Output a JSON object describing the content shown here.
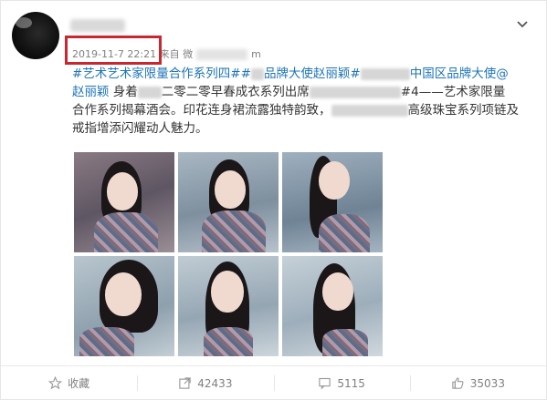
{
  "post": {
    "timestamp": "2019-11-7 22:21",
    "source_prefix": "来自 微",
    "source_suffix": "m",
    "text": {
      "t1": "#艺术艺术家限量合作系列四##",
      "t2": "品牌大使赵丽颖#",
      "t3": "中国区品牌大使",
      "t4": "@",
      "t5": "赵丽颖",
      "t6": " 身着",
      "t7": "二零二零早春成衣系列出席",
      "t8": "#4——艺术家限量",
      "t9": "合作系列揭幕酒会。印花连身裙流露独特韵致，",
      "t10": "高级珠宝系列项链及",
      "t11": "戒指增添闪耀动人魅力。"
    }
  },
  "actions": {
    "favorite": "收藏",
    "repost": "42433",
    "comment": "5115",
    "like": "35033"
  },
  "colors": {
    "link": "#1d74b8",
    "highlight_box": "#c9262f",
    "muted": "#808080"
  }
}
